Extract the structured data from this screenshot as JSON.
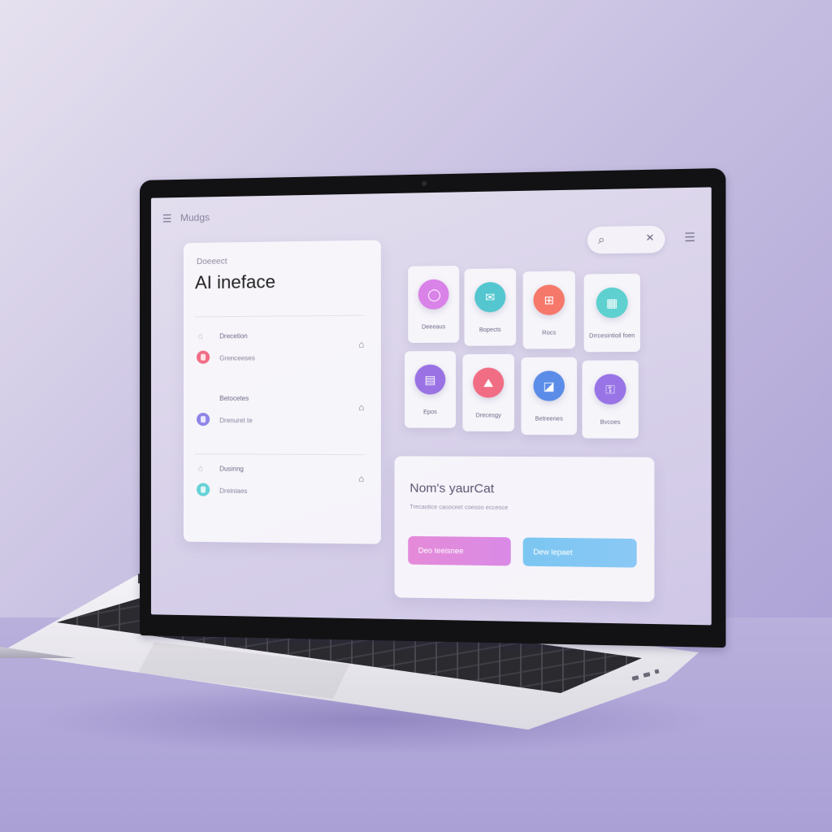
{
  "app": {
    "title": "Mudgs"
  },
  "left_panel": {
    "kicker": "Doeeect",
    "title": "AI ineface",
    "rows": [
      {
        "label1": "Drecetion",
        "label2": "Grenceeses",
        "dot_color": "#f16d84"
      },
      {
        "label1": "Betocetes",
        "label2": "Drenuret te",
        "dot_color": "#8f86e8"
      },
      {
        "label1": "Dusinng",
        "label2": "Dreiniaes",
        "dot_color": "#64d2d6"
      }
    ]
  },
  "tiles": [
    {
      "label": "Deeeaus",
      "color": "#d982e8",
      "icon": "message-icon",
      "glyph": "◯"
    },
    {
      "label": "Bopects",
      "color": "#53c6cf",
      "icon": "mail-icon",
      "glyph": "✉"
    },
    {
      "label": "Rocs",
      "color": "#f5786a",
      "icon": "image-icon",
      "glyph": "⊞"
    },
    {
      "label": "Drrcesintioil foen",
      "color": "#5dd0cf",
      "icon": "calendar-icon",
      "glyph": "▦"
    },
    {
      "label": "Epos",
      "color": "#9a72e4",
      "icon": "chat-icon",
      "glyph": "▤"
    },
    {
      "label": "Drecesgy",
      "color": "#f16d84",
      "icon": "photo-icon",
      "glyph": "⛰"
    },
    {
      "label": "Betreenes",
      "color": "#5b8de8",
      "icon": "landscape-icon",
      "glyph": "◪"
    },
    {
      "label": "Bvcoes",
      "color": "#9874e6",
      "icon": "lock-icon",
      "glyph": "🔒"
    }
  ],
  "prompt_card": {
    "title": "Nom's yaurCat",
    "subtitle": "Trecaotice casoceet coesoo ecceoce",
    "button_primary": "Deo teeisnee",
    "button_secondary": "Dew lepaet"
  },
  "colors": {
    "accent_pink": "#e58ad8",
    "accent_blue": "#7cc6f2"
  }
}
